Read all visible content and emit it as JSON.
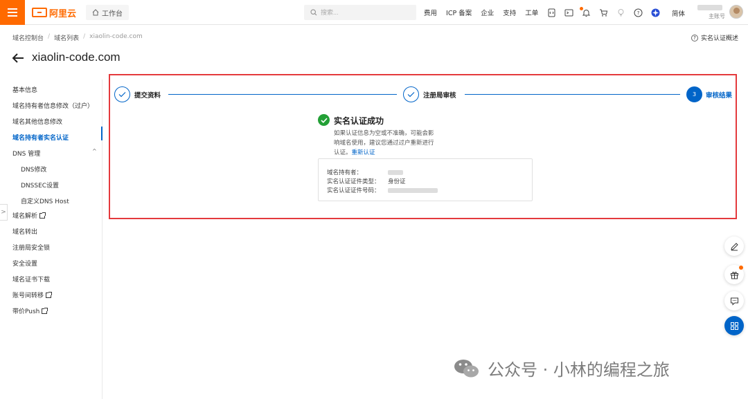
{
  "topbar": {
    "logo": "阿里云",
    "workbench": "工作台",
    "search_placeholder": "搜索...",
    "links": [
      "费用",
      "ICP 备案",
      "企业",
      "支持",
      "工单"
    ],
    "language": "简体",
    "account_sub": "主账号"
  },
  "breadcrumb": [
    "域名控制台",
    "域名列表",
    "xiaolin-code.com"
  ],
  "overview_link": "实名认证概述",
  "page_title": "xiaolin-code.com",
  "sidebar": {
    "items": [
      {
        "label": "基本信息"
      },
      {
        "label": "域名持有者信息修改（过户）"
      },
      {
        "label": "域名其他信息修改"
      },
      {
        "label": "域名持有者实名认证"
      },
      {
        "label": "DNS 管理"
      },
      {
        "label": "DNS修改"
      },
      {
        "label": "DNSSEC设置"
      },
      {
        "label": "自定义DNS Host"
      },
      {
        "label": "域名解析"
      },
      {
        "label": "域名转出"
      },
      {
        "label": "注册局安全锁"
      },
      {
        "label": "安全设置"
      },
      {
        "label": "域名证书下载"
      },
      {
        "label": "账号间转移"
      },
      {
        "label": "带价Push"
      }
    ]
  },
  "steps": [
    {
      "label": "提交资料"
    },
    {
      "label": "注册局审核"
    },
    {
      "label": "审核结果",
      "number": "3"
    }
  ],
  "result": {
    "title": "实名认证成功",
    "desc": "如果认证信息为空或不准确，可能会影响域名使用，建议您通过过户重新进行认证。",
    "link": "重新认证"
  },
  "info": {
    "holder_label": "域名持有者：",
    "cert_type_label": "实名认证证件类型：",
    "cert_type_value": "身份证",
    "cert_no_label": "实名认证证件号码："
  },
  "watermark": "公众号 · 小林的编程之旅"
}
